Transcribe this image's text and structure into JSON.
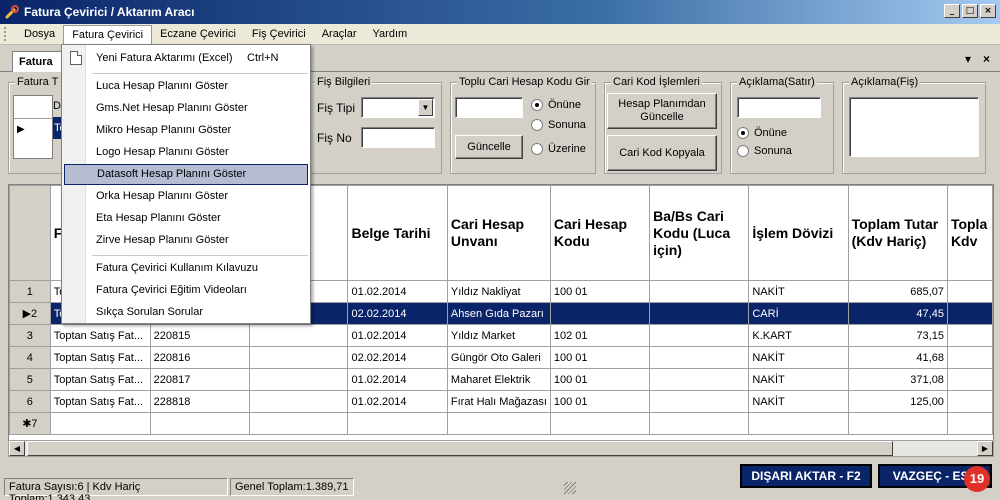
{
  "window": {
    "title": "Fatura Çevirici / Aktarım Aracı",
    "min": "_",
    "max": "□",
    "close": "×"
  },
  "menubar": [
    "Dosya",
    "Fatura Çevirici",
    "Eczane Çevirici",
    "Fiş Çevirici",
    "Araçlar",
    "Yardım"
  ],
  "doc_tab": {
    "label": "Fatura",
    "pin": "▾",
    "close": "×"
  },
  "dropdown": {
    "items": [
      {
        "label": "Yeni Fatura Aktarımı (Excel)",
        "shortcut": "Ctrl+N"
      },
      {
        "label": "Luca Hesap Planını Göster"
      },
      {
        "label": "Gms.Net Hesap Planını Göster"
      },
      {
        "label": "Mikro Hesap Planını Göster"
      },
      {
        "label": "Logo Hesap Planını Göster"
      },
      {
        "label": "Datasoft Hesap Planını Göster"
      },
      {
        "label": "Orka Hesap Planını Göster"
      },
      {
        "label": "Eta Hesap Planını Göster"
      },
      {
        "label": "Zirve Hesap Planını Göster"
      },
      {
        "label": "Fatura Çevirici Kullanım Kılavuzu"
      },
      {
        "label": "Fatura Çevirici Eğitim Videoları"
      },
      {
        "label": "Sıkça Sorulan Sorular"
      }
    ]
  },
  "form": {
    "fatura_group": {
      "legend": "Fatura T",
      "partial_col": "D",
      "partial_cell": "To"
    },
    "fis_bilgileri": {
      "legend": "Fiş Bilgileri",
      "fis_tipi": "Fiş Tipi",
      "fis_no": "Fiş No"
    },
    "toplu_cari": {
      "legend": "Toplu Cari Hesap Kodu Gir",
      "onune": "Önüne",
      "sonuna": "Sonuna",
      "uzerine": "Üzerine",
      "guncelle": "Güncelle"
    },
    "cari_kod": {
      "legend": "Cari Kod İşlemleri",
      "btn1_line1": "Hesap Planımdan",
      "btn1_line2": "Güncelle",
      "btn2": "Cari Kod Kopyala"
    },
    "aciklama_satir": {
      "legend": "Açıklama(Satır)",
      "onune": "Önüne",
      "sonuna": "Sonuna"
    },
    "aciklama_fis": {
      "legend": "Açıklama(Fiş)"
    }
  },
  "grid": {
    "columns": [
      "F T",
      "",
      "",
      "Belge Tarihi",
      "Cari Hesap Unvanı",
      "Cari Hesap Kodu",
      "Ba/Bs Cari Kodu (Luca için)",
      "İşlem Dövizi",
      "Toplam Tutar (Kdv Hariç)",
      "Topla Kdv"
    ],
    "rows": [
      {
        "num": "1",
        "type": "Toptan Satış Fat...",
        "no": "",
        "date": "01.02.2014",
        "name": "Yıldız Nakliyat",
        "code": "100 01",
        "babs": "",
        "doviz": "NAKİT",
        "tutar": "685,07"
      },
      {
        "num": "2",
        "type": "Toptan Satış Fat...",
        "no": "",
        "date": "02.02.2014",
        "name": "Ahsen Gıda Pazarı",
        "code": "",
        "babs": "",
        "doviz": "CARİ",
        "tutar": "47,45"
      },
      {
        "num": "3",
        "type": "Toptan Satış Fat...",
        "no": "220815",
        "date": "01.02.2014",
        "name": "Yıldız Market",
        "code": "102 01",
        "babs": "",
        "doviz": "K.KART",
        "tutar": "73,15"
      },
      {
        "num": "4",
        "type": "Toptan Satış Fat...",
        "no": "220816",
        "date": "02.02.2014",
        "name": "Güngör Oto Galeri",
        "code": "100 01",
        "babs": "",
        "doviz": "NAKİT",
        "tutar": "41,68"
      },
      {
        "num": "5",
        "type": "Toptan Satış Fat...",
        "no": "220817",
        "date": "01.02.2014",
        "name": "Maharet Elektrik",
        "code": "100 01",
        "babs": "",
        "doviz": "NAKİT",
        "tutar": "371,08"
      },
      {
        "num": "6",
        "type": "Toptan Satış Fat...",
        "no": "228818",
        "date": "01.02.2014",
        "name": "Fırat Halı Mağazası",
        "code": "100 01",
        "babs": "",
        "doviz": "NAKİT",
        "tutar": "125,00"
      }
    ],
    "new_row": "✱7"
  },
  "status": {
    "summary": "Fatura Sayısı:6 | Kdv Hariç Toplam:1.343,43",
    "genel": "Genel Toplam:1.389,71"
  },
  "buttons": {
    "export": "DIŞARI AKTAR - F2",
    "cancel": "VAZGEÇ - ESC"
  },
  "badge": "19",
  "colors": {
    "selection": "#0a246a",
    "menu_highlight": "#b6bdd2",
    "badge": "#e0302a"
  }
}
